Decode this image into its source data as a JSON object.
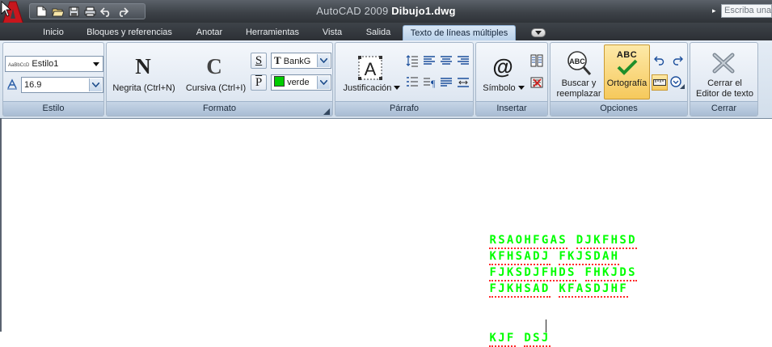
{
  "titlebar": {
    "app_name": "AutoCAD 2009",
    "file_name": "Dibujo1.dwg",
    "search_placeholder": "Escriba una"
  },
  "quick_access": [
    "new-icon",
    "open-icon",
    "save-icon",
    "plot-icon",
    "undo-icon",
    "redo-icon"
  ],
  "tabs": [
    {
      "label": "Inicio"
    },
    {
      "label": "Bloques y referencias"
    },
    {
      "label": "Anotar"
    },
    {
      "label": "Herramientas"
    },
    {
      "label": "Vista"
    },
    {
      "label": "Salida"
    },
    {
      "label": "Texto de líneas múltiples",
      "active": true
    }
  ],
  "ribbon": {
    "estilo": {
      "label": "Estilo",
      "style_value": "Estilo1",
      "style_preview": "AaBbCcD",
      "height_value": "16.9"
    },
    "formato": {
      "label": "Formato",
      "bold_label": "Negrita (Ctrl+N)",
      "bold_glyph": "N",
      "italic_label": "Cursiva (Ctrl+I)",
      "italic_glyph": "C",
      "underline_glyph": "S",
      "overline_glyph": "P",
      "font_value": "BankG",
      "font_glyph": "T",
      "color_value": "verde",
      "color_swatch": "#00cc00"
    },
    "parrafo": {
      "label": "Párrafo",
      "justify_label": "Justificación",
      "justify_glyph": "A"
    },
    "insertar": {
      "label": "Insertar",
      "symbol_label": "Símbolo",
      "symbol_glyph": "@"
    },
    "opciones": {
      "label": "Opciones",
      "find_label_1": "Buscar y",
      "find_label_2": "reemplazar",
      "find_glyph": "ABC",
      "spell_label": "Ortografía",
      "spell_glyph": "ABC"
    },
    "cerrar": {
      "label": "Cerrar",
      "close_label_1": "Cerrar el",
      "close_label_2": "Editor de texto",
      "close_glyph": "X"
    }
  },
  "mtext": {
    "color": "#00ff00",
    "lines": [
      [
        "RSAOHFGAS",
        "DJKFHSD"
      ],
      [
        "KFHSADJ",
        "FKJSDAH"
      ],
      [
        "FJKSDJFHDS",
        "FHKJDS"
      ],
      [
        "FJKHSAD",
        "KFASDJHF"
      ],
      [],
      [
        "KJF",
        "DSJ"
      ]
    ]
  }
}
